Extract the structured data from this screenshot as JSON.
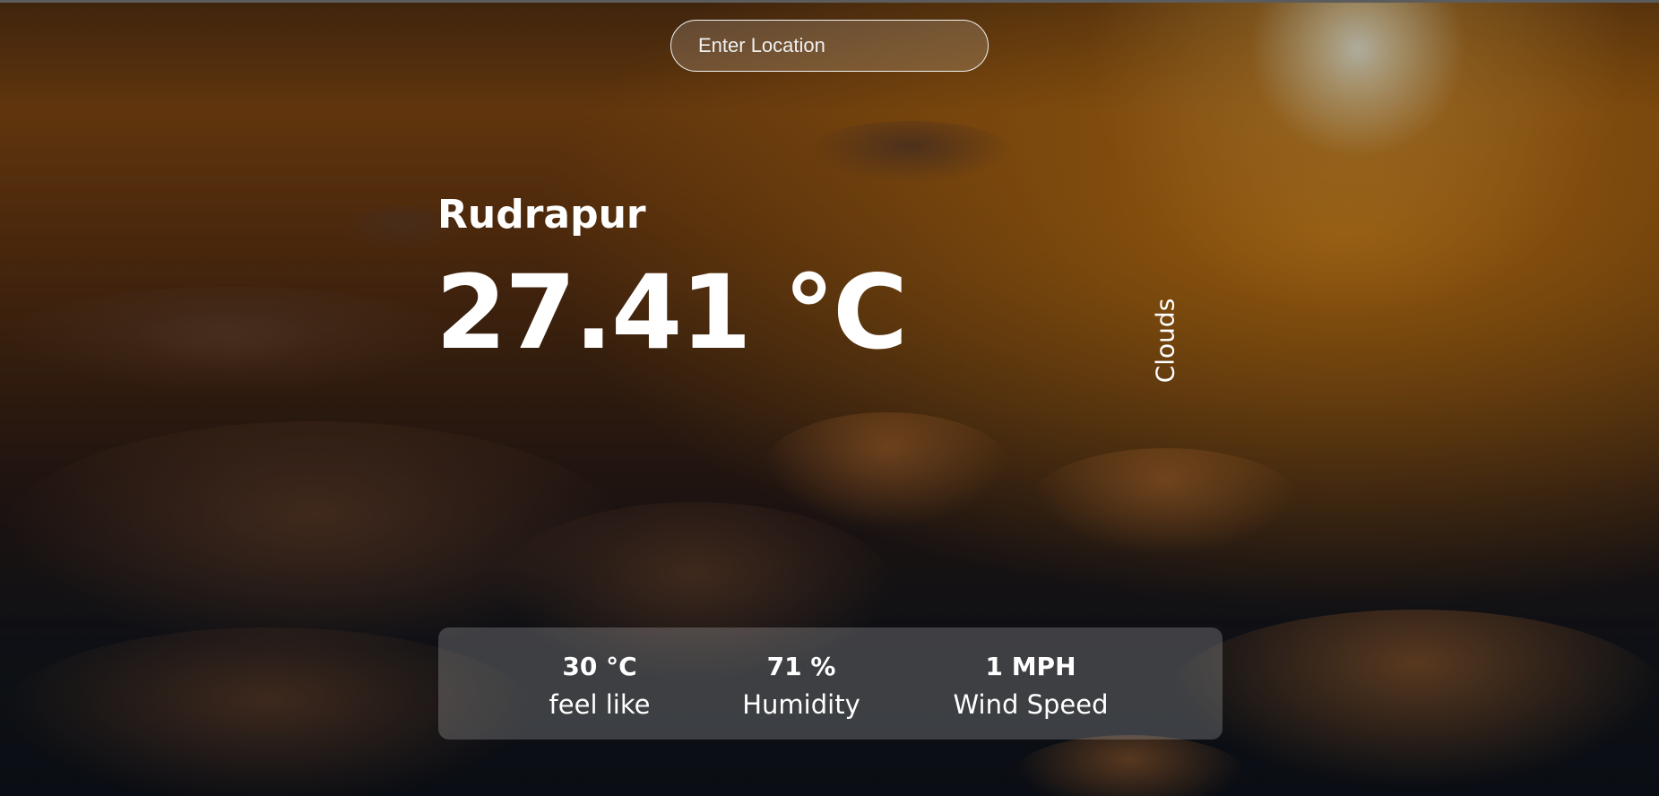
{
  "search": {
    "placeholder": "Enter Location",
    "value": ""
  },
  "weather": {
    "city": "Rudrapur",
    "temperature": "27.41 °C",
    "condition": "Clouds"
  },
  "stats": [
    {
      "value": "30 °C",
      "label": "feel like"
    },
    {
      "value": "71 %",
      "label": "Humidity"
    },
    {
      "value": "1 MPH",
      "label": "Wind Speed"
    }
  ],
  "background": {
    "description_icon": "sunset-clouds-background",
    "sky_accent": "#d98a1c",
    "cloud_shadow": "#16181f"
  }
}
